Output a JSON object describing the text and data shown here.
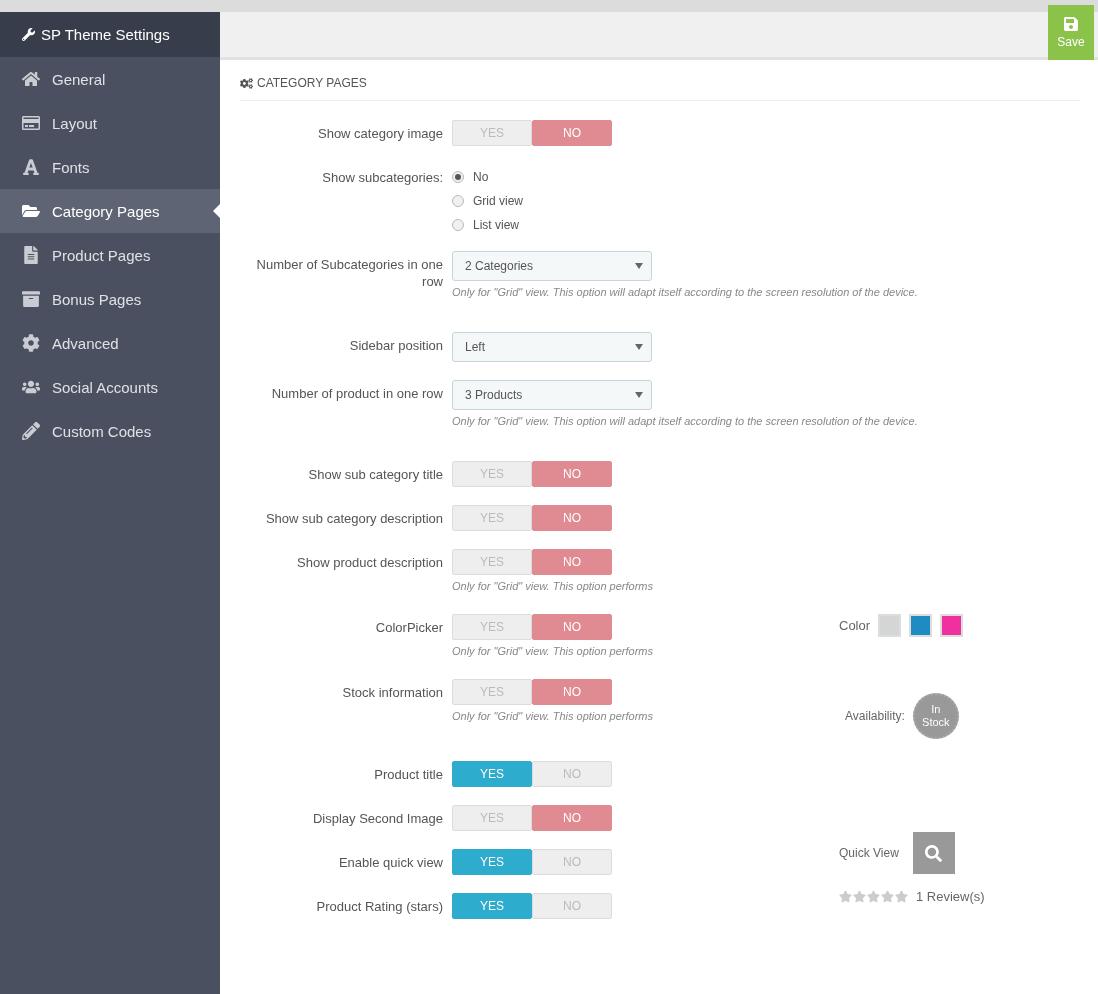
{
  "sidebar": {
    "title": "SP Theme Settings",
    "items": [
      {
        "label": "General",
        "selected": false
      },
      {
        "label": "Layout",
        "selected": false
      },
      {
        "label": "Fonts",
        "selected": false
      },
      {
        "label": "Category Pages",
        "selected": true
      },
      {
        "label": "Product Pages",
        "selected": false
      },
      {
        "label": "Bonus Pages",
        "selected": false
      },
      {
        "label": "Advanced",
        "selected": false
      },
      {
        "label": "Social Accounts",
        "selected": false
      },
      {
        "label": "Custom Codes",
        "selected": false
      }
    ]
  },
  "toolbar": {
    "save": "Save"
  },
  "section": {
    "title": "CATEGORY PAGES",
    "rows": [
      {
        "kind": "toggle",
        "label": "Show category image",
        "yes": "YES",
        "no": "NO",
        "on": false
      },
      {
        "kind": "radio",
        "label": "Show subcategories:",
        "options": [
          {
            "label": "No",
            "selected": true
          },
          {
            "label": "Grid view",
            "selected": false
          },
          {
            "label": "List view",
            "selected": false
          }
        ]
      },
      {
        "kind": "select",
        "label": "Number of Subcategories in one row",
        "value": "2 Categories",
        "help": "Only for \"Grid\" view. This option will adapt itself according to the screen resolution of the device."
      },
      {
        "kind": "select",
        "label": "Sidebar position",
        "value": "Left"
      },
      {
        "kind": "select",
        "label": "Number of product in one row",
        "value": "3 Products",
        "help": "Only for \"Grid\" view. This option will adapt itself according to the screen resolution of the device."
      },
      {
        "kind": "toggle",
        "label": "Show sub category title",
        "yes": "YES",
        "no": "NO",
        "on": false
      },
      {
        "kind": "toggle",
        "label": "Show sub category description",
        "yes": "YES",
        "no": "NO",
        "on": false
      },
      {
        "kind": "toggle",
        "label": "Show product description",
        "yes": "YES",
        "no": "NO",
        "on": false,
        "help": "Only for \"Grid\" view. This option performs"
      },
      {
        "kind": "toggle",
        "label": "ColorPicker",
        "yes": "YES",
        "no": "NO",
        "on": false,
        "help": "Only for \"Grid\" view. This option performs",
        "preview": {
          "kind": "color",
          "label": "Color",
          "swatches": [
            {
              "color": "#d3d6d5"
            },
            {
              "color": "#1e8bc3"
            },
            {
              "color": "#f0309e"
            }
          ]
        }
      },
      {
        "kind": "toggle",
        "label": "Stock information",
        "yes": "YES",
        "no": "NO",
        "on": false,
        "help": "Only for \"Grid\" view. This option performs",
        "preview": {
          "kind": "stock",
          "label": "Availability:",
          "badge": "In Stock"
        }
      },
      {
        "kind": "toggle",
        "label": "Product title",
        "yes": "YES",
        "no": "NO",
        "on": true
      },
      {
        "kind": "toggle",
        "label": "Display Second Image",
        "yes": "YES",
        "no": "NO",
        "on": false
      },
      {
        "kind": "toggle",
        "label": "Enable quick view",
        "yes": "YES",
        "no": "NO",
        "on": true,
        "preview": {
          "kind": "quickview",
          "label": "Quick View",
          "stars": 0,
          "reviews": "1 Review(s)"
        }
      },
      {
        "kind": "toggle",
        "label": "Product Rating (stars)",
        "yes": "YES",
        "no": "NO",
        "on": true
      }
    ]
  }
}
